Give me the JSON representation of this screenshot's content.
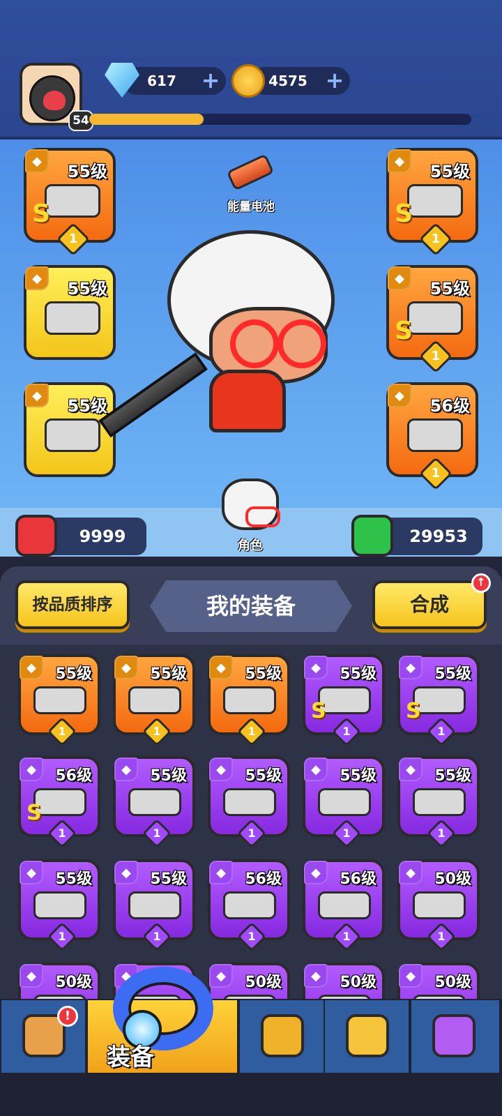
{
  "header": {
    "player_level": "54",
    "xp_progress": 0.3,
    "gems": "617",
    "coins": "4575",
    "plus": "+"
  },
  "hero": {
    "battery_label": "能量电池",
    "character_label": "角色",
    "attack": "9999",
    "hp": "29953",
    "left_slots": [
      {
        "type_icon": "gun-icon",
        "level": "55级",
        "rank": "S",
        "count": "1",
        "rarity": "orange",
        "item": "dagger"
      },
      {
        "type_icon": "glove-icon",
        "level": "55级",
        "rank": "",
        "count": "",
        "rarity": "yellow",
        "item": "gloves"
      },
      {
        "type_icon": "ring-icon",
        "level": "55级",
        "rank": "",
        "count": "",
        "rarity": "yellow",
        "item": "ring"
      }
    ],
    "right_slots": [
      {
        "type_icon": "armor-icon",
        "level": "55级",
        "rank": "S",
        "count": "1",
        "rarity": "orange",
        "item": "armor"
      },
      {
        "type_icon": "belt-icon",
        "level": "55级",
        "rank": "S",
        "count": "1",
        "rarity": "orange",
        "item": "belt"
      },
      {
        "type_icon": "boot-icon",
        "level": "56级",
        "rank": "",
        "count": "1",
        "rarity": "orange",
        "item": "boots"
      }
    ]
  },
  "equipment": {
    "sort_button": "按品质排序",
    "title": "我的装备",
    "merge_button": "合成",
    "merge_badge": "↑",
    "items": [
      {
        "level": "55级",
        "rank": "",
        "count": "1",
        "rarity": "orange",
        "item": "pistol"
      },
      {
        "level": "55级",
        "rank": "",
        "count": "1",
        "rarity": "orange",
        "item": "coat"
      },
      {
        "level": "55级",
        "rank": "",
        "count": "1",
        "rarity": "orange",
        "item": "belt"
      },
      {
        "level": "55级",
        "rank": "S",
        "count": "1",
        "rarity": "purple",
        "item": "dagger"
      },
      {
        "level": "55级",
        "rank": "S",
        "count": "1",
        "rarity": "purple",
        "item": "gloves"
      },
      {
        "level": "56级",
        "rank": "S",
        "count": "1",
        "rarity": "purple",
        "item": "boots"
      },
      {
        "level": "55级",
        "rank": "",
        "count": "1",
        "rarity": "purple",
        "item": "pistol"
      },
      {
        "level": "55级",
        "rank": "",
        "count": "1",
        "rarity": "purple",
        "item": "knife"
      },
      {
        "level": "55级",
        "rank": "",
        "count": "1",
        "rarity": "purple",
        "item": "ring"
      },
      {
        "level": "55级",
        "rank": "",
        "count": "1",
        "rarity": "purple",
        "item": "belt"
      },
      {
        "level": "55级",
        "rank": "",
        "count": "1",
        "rarity": "purple",
        "item": "gloves"
      },
      {
        "level": "55级",
        "rank": "",
        "count": "1",
        "rarity": "purple",
        "item": "gloves"
      },
      {
        "level": "56级",
        "rank": "",
        "count": "1",
        "rarity": "purple",
        "item": "boots"
      },
      {
        "level": "56级",
        "rank": "",
        "count": "1",
        "rarity": "purple",
        "item": "boots"
      },
      {
        "level": "50级",
        "rank": "",
        "count": "1",
        "rarity": "purple",
        "item": "crossbow"
      },
      {
        "level": "50级",
        "rank": "",
        "count": "",
        "rarity": "purple",
        "item": "pistol"
      },
      {
        "level": "",
        "rank": "",
        "count": "",
        "rarity": "purple",
        "item": "armor"
      },
      {
        "level": "50级",
        "rank": "",
        "count": "",
        "rarity": "purple",
        "item": "armor"
      },
      {
        "level": "50级",
        "rank": "",
        "count": "",
        "rarity": "purple",
        "item": "armor"
      },
      {
        "level": "50级",
        "rank": "",
        "count": "",
        "rarity": "purple",
        "item": "armor"
      }
    ]
  },
  "nav": {
    "tabs": [
      {
        "icon": "shop-icon",
        "label": "",
        "badge": "!"
      },
      {
        "icon": "equipment-ring-icon",
        "label": "装备",
        "badge": ""
      },
      {
        "icon": "battle-star-icon",
        "label": "",
        "badge": ""
      },
      {
        "icon": "egg-chick-icon",
        "label": "",
        "badge": ""
      },
      {
        "icon": "capsule-icon",
        "label": "",
        "badge": ""
      }
    ]
  },
  "colors": {
    "orange": "#f46a10",
    "yellow": "#f3c51a",
    "purple": "#8629e0",
    "attack_red": "#e8363c",
    "hp_green": "#2ec24a"
  }
}
